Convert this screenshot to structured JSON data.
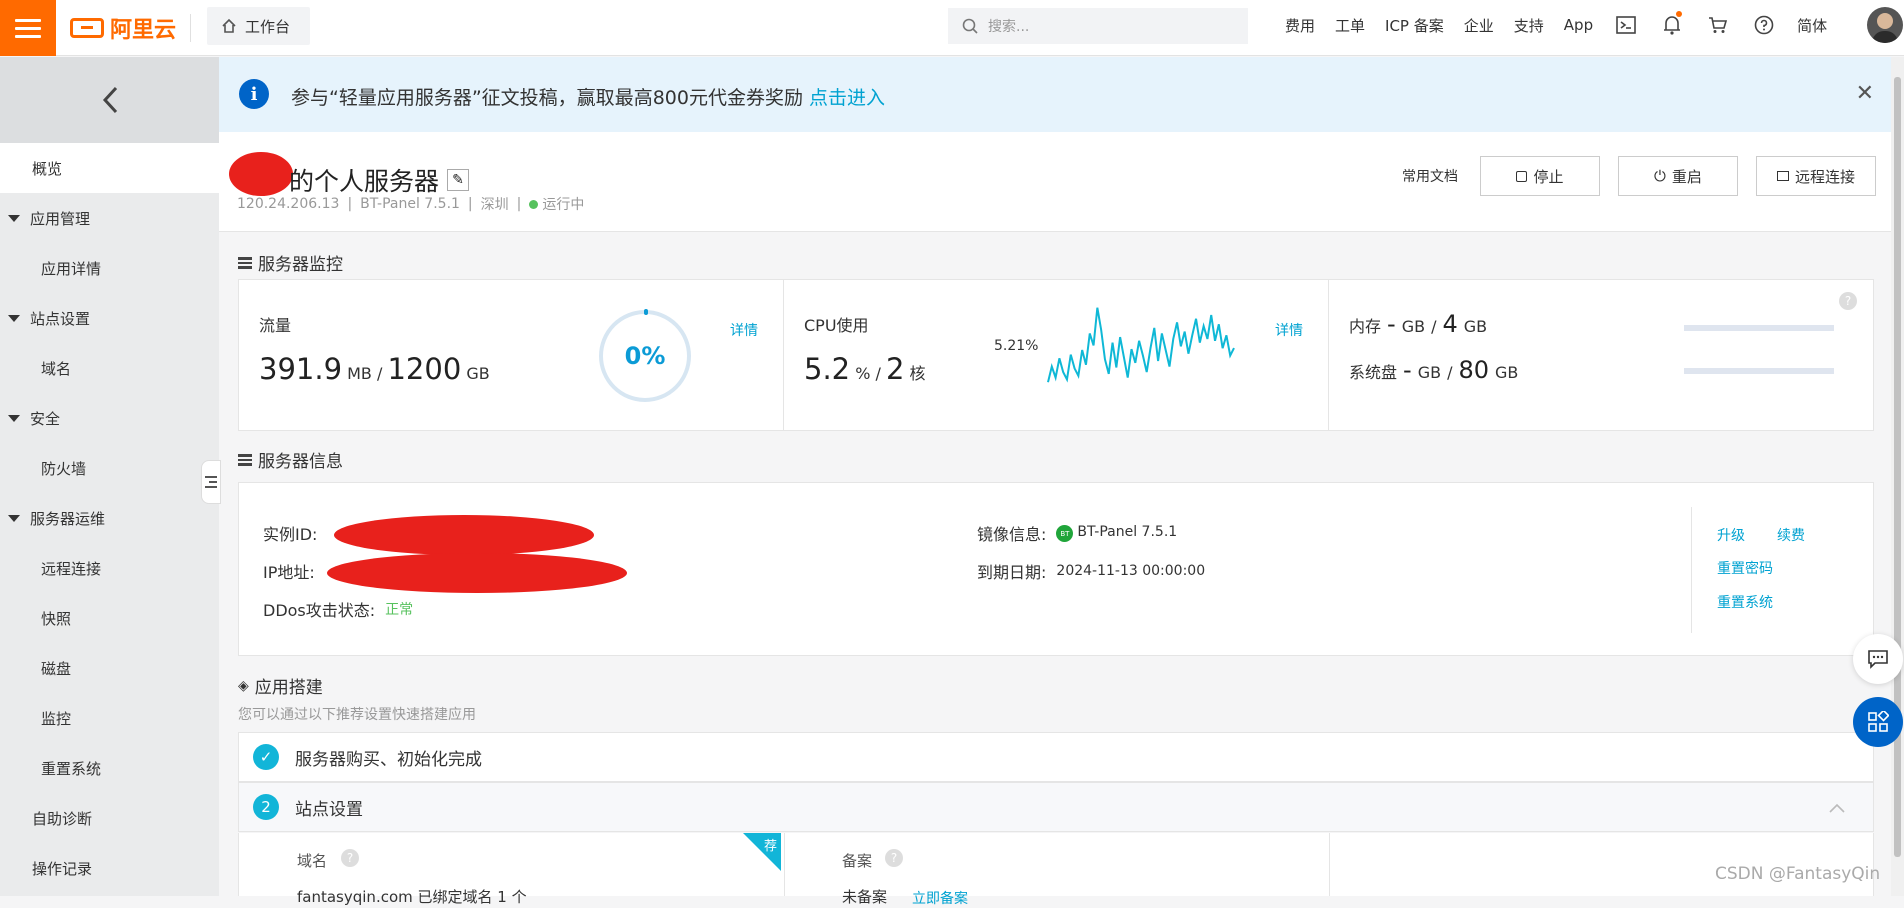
{
  "topbar": {
    "logo_text": "阿里云",
    "workbench": "工作台",
    "search_placeholder": "搜索...",
    "nav": [
      "费用",
      "工单",
      "ICP 备案",
      "企业",
      "支持",
      "App"
    ],
    "lang": "简体",
    "icons": [
      "terminal-icon",
      "bell-icon",
      "cart-icon",
      "help-icon"
    ]
  },
  "sidebar": {
    "overview": "概览",
    "app_mgmt": "应用管理",
    "app_detail": "应用详情",
    "site_settings": "站点设置",
    "domain": "域名",
    "security": "安全",
    "firewall": "防火墙",
    "ops": "服务器运维",
    "remote": "远程连接",
    "snapshot": "快照",
    "disk": "磁盘",
    "monitor": "监控",
    "reset_system": "重置系统",
    "self_diagnose": "自助诊断",
    "op_log": "操作记录"
  },
  "notice": {
    "text": "参与“轻量应用服务器”征文投稿，赢取最高800元代金券奖励",
    "link": "点击进入"
  },
  "server": {
    "title": "的个人服务器",
    "ip": "120.24.206.13",
    "image": "BT-Panel 7.5.1",
    "region": "深圳",
    "status": "运行中",
    "docs": "常用文档",
    "stop": "停止",
    "restart": "重启",
    "remote": "远程连接"
  },
  "monitor": {
    "section_title": "服务器监控",
    "traffic_label": "流量",
    "traffic_used": "391.9",
    "traffic_used_unit": "MB",
    "traffic_total": "1200",
    "traffic_total_unit": "GB",
    "traffic_pct": "0%",
    "detail": "详情",
    "cpu_label": "CPU使用",
    "cpu_value": "5.2",
    "cpu_unit": "%",
    "cpu_cores": "2",
    "cpu_cores_unit": "核",
    "cpu_current": "5.21%",
    "cpu_series": [
      1.5,
      3.2,
      2.0,
      4.1,
      2.6,
      1.8,
      4.5,
      3.0,
      2.2,
      5.0,
      3.4,
      6.8,
      5.5,
      9.6,
      7.2,
      4.0,
      2.4,
      5.8,
      3.1,
      6.4,
      4.2,
      2.0,
      5.1,
      3.6,
      6.0,
      4.4,
      2.6,
      5.2,
      7.4,
      3.8,
      6.8,
      5.0,
      3.2,
      6.2,
      8.0,
      5.4,
      7.0,
      4.6,
      6.6,
      8.4,
      5.8,
      7.6,
      6.2,
      8.8,
      6.0,
      7.8,
      5.2,
      6.6,
      4.4,
      5.21
    ],
    "mem_label": "内存",
    "mem_used": "-",
    "mem_unit": "GB",
    "mem_total": "4",
    "disk_label": "系统盘",
    "disk_used": "-",
    "disk_total": "80",
    "disk_unit": "GB"
  },
  "info": {
    "section_title": "服务器信息",
    "instance_label": "实例ID:",
    "ip_label": "IP地址:",
    "ddos_label": "DDos攻击状态:",
    "ddos_value": "正常",
    "image_label": "镜像信息:",
    "image_value": "BT-Panel 7.5.1",
    "bt_badge": "BT",
    "expire_label": "到期日期:",
    "expire_value": "2024-11-13 00:00:00",
    "upgrade": "升级",
    "renew": "续费",
    "reset_pwd": "重置密码",
    "reset_sys": "重置系统"
  },
  "build": {
    "section_title": "应用搭建",
    "subtitle": "您可以通过以下推荐设置快速搭建应用",
    "step1": "服务器购买、初始化完成",
    "step2_num": "2",
    "step2": "站点设置",
    "domain_label": "域名",
    "icp_label": "备案",
    "corner": "荐",
    "domain_status": "fantasyqin.com 已绑定域名 1 个",
    "icp_status": "未备案",
    "icp_link": "立即备案"
  },
  "watermark": "CSDN @FantasyQin",
  "colors": {
    "accent": "#ff6a00",
    "link": "#00a2d1",
    "cpu_line": "#0fb8d6",
    "ok": "#57c25e"
  }
}
